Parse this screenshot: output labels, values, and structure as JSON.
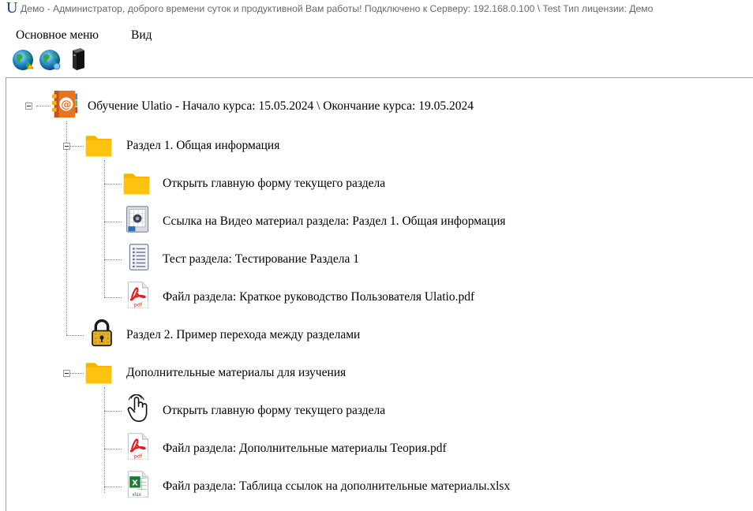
{
  "window": {
    "logo_letter": "U",
    "title": "Демо - Администратор, доброго времени суток и продуктивной Вам работы! Подключено к Серверу: 192.168.0.100 \\ Test Тип лицензии: Демо"
  },
  "menu": {
    "items": [
      {
        "label": "Основное меню"
      },
      {
        "label": "Вид"
      }
    ]
  },
  "toolbar": {
    "buttons": [
      {
        "icon": "globe-up-icon"
      },
      {
        "icon": "globe-down-icon"
      },
      {
        "icon": "server-icon"
      }
    ]
  },
  "tree": {
    "root": {
      "icon": "address-book-icon",
      "label": "Обучение Ulatio - Начало курса: 15.05.2024 \\ Окончание курса: 19.05.2024",
      "sections": [
        {
          "icon": "folder-icon",
          "label": "Раздел 1. Общая информация",
          "expanded": true,
          "children": [
            {
              "icon": "folder-icon",
              "label": "Открыть главную форму текущего раздела"
            },
            {
              "icon": "video-icon",
              "label": "Ссылка на Видео материал раздела: Раздел 1. Общая информация"
            },
            {
              "icon": "test-list-icon",
              "label": "Тест раздела: Тестирование Раздела 1"
            },
            {
              "icon": "pdf-icon",
              "label": "Файл раздела: Краткое руководство Пользователя Ulatio.pdf"
            }
          ]
        },
        {
          "icon": "lock-icon",
          "label": "Раздел 2. Пример перехода между разделами",
          "expanded": false,
          "children": []
        },
        {
          "icon": "folder-icon",
          "label": "Дополнительные материалы для изучения",
          "expanded": true,
          "children": [
            {
              "icon": "hand-pointer-icon",
              "label": "Открыть главную форму текущего раздела"
            },
            {
              "icon": "pdf-icon",
              "label": "Файл раздела: Дополнительные материалы Теория.pdf"
            },
            {
              "icon": "excel-icon",
              "label": "Файл раздела: Таблица ссылок на дополнительные материалы.xlsx"
            }
          ]
        }
      ]
    }
  },
  "colors": {
    "folder": "#ffc20e",
    "pdf_red": "#e02020",
    "excel_green": "#1d7a3a",
    "logo_blue": "#1a3d8f"
  }
}
